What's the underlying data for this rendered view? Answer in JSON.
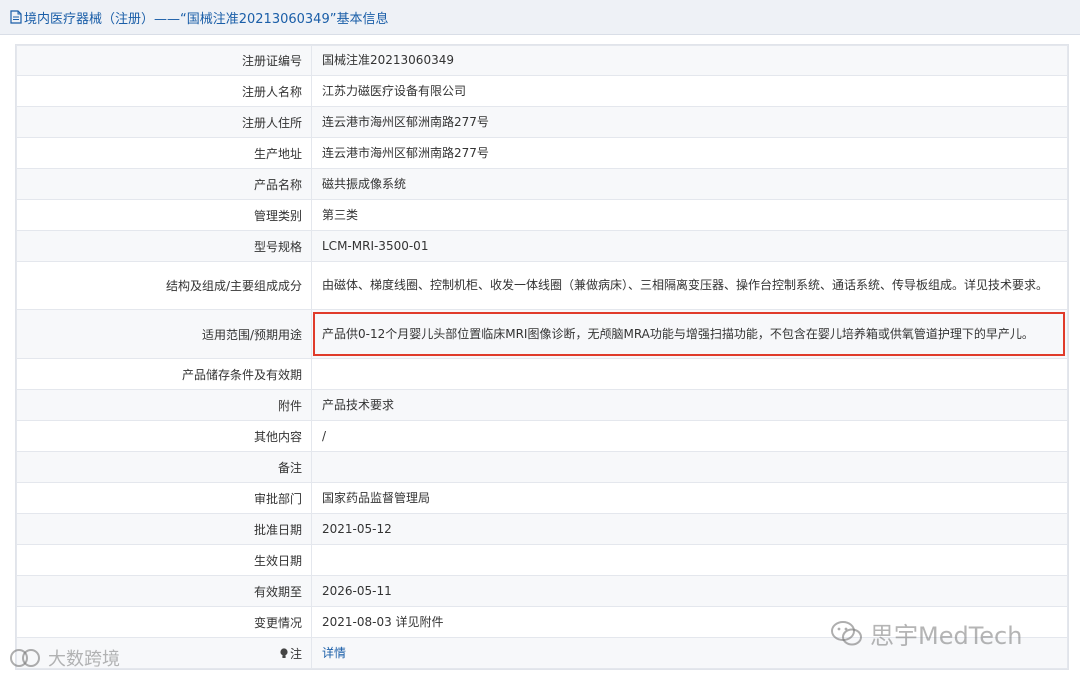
{
  "header": {
    "title": "境内医疗器械（注册）——“国械注准20213060349”基本信息"
  },
  "rows": [
    {
      "label": "注册证编号",
      "value": "国械注准20213060349"
    },
    {
      "label": "注册人名称",
      "value": "江苏力磁医疗设备有限公司"
    },
    {
      "label": "注册人住所",
      "value": "连云港市海州区郁洲南路277号"
    },
    {
      "label": "生产地址",
      "value": "连云港市海州区郁洲南路277号"
    },
    {
      "label": "产品名称",
      "value": "磁共振成像系统"
    },
    {
      "label": "管理类别",
      "value": "第三类"
    },
    {
      "label": "型号规格",
      "value": "LCM-MRI-3500-01"
    },
    {
      "label": "结构及组成/主要组成成分",
      "value": "由磁体、梯度线圈、控制机柜、收发一体线圈（兼做病床）、三相隔离变压器、操作台控制系统、通话系统、传导板组成。详见技术要求。"
    },
    {
      "label": "适用范围/预期用途",
      "value": "产品供0-12个月婴儿头部位置临床MRI图像诊断，无颅脑MRA功能与增强扫描功能，不包含在婴儿培养箱或供氧管道护理下的早产儿。"
    },
    {
      "label": "产品储存条件及有效期",
      "value": ""
    },
    {
      "label": "附件",
      "value": "产品技术要求"
    },
    {
      "label": "其他内容",
      "value": "/"
    },
    {
      "label": "备注",
      "value": ""
    },
    {
      "label": "审批部门",
      "value": "国家药品监督管理局"
    },
    {
      "label": "批准日期",
      "value": "2021-05-12"
    },
    {
      "label": "生效日期",
      "value": ""
    },
    {
      "label": "有效期至",
      "value": "2026-05-11"
    },
    {
      "label": "变更情况",
      "value": "2021-08-03 详见附件"
    },
    {
      "label": "注",
      "value": "详情"
    }
  ],
  "watermarks": {
    "right": "思宇MedTech",
    "left": "大数跨境"
  },
  "colors": {
    "link": "#1a5ea8",
    "highlight_border": "#e03b2a",
    "header_bg": "#eef1f6"
  }
}
